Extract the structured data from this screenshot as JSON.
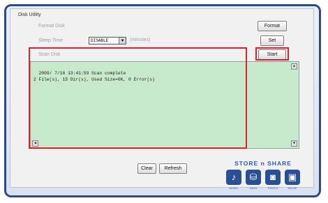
{
  "panel": {
    "title": "Disk Utility",
    "format_disk_label": "Format Disk",
    "sleep_time_label": "Sleep Time",
    "sleep_time_value": "DISABLE",
    "sleep_time_unit": "(minutes)",
    "scan_disk_label": "Scan Disk"
  },
  "buttons": {
    "format": "Format",
    "set": "Set",
    "start": "Start",
    "clear": "Clear",
    "refresh": "Refresh"
  },
  "log": {
    "text": "2009/ 7/16 13:41:59 Scan complete\n2 File(s), 15 Dir(s), Used Size=0K, 0 Error(s)"
  },
  "logo": {
    "title": "STORE n SHARE",
    "tiles": [
      {
        "icon": "music-icon",
        "glyph": "♪",
        "label": "MUSIC"
      },
      {
        "icon": "data-icon",
        "glyph": "⛁",
        "label": "DATA"
      },
      {
        "icon": "photo-icon",
        "glyph": "◙",
        "label": "PHOTO"
      },
      {
        "icon": "movie-icon",
        "glyph": "▣",
        "label": "MOVIE"
      }
    ]
  },
  "colors": {
    "frame": "#2d4a86",
    "log_background": "#c7eacc",
    "highlight": "#e0202a",
    "brand": "#2f5aa8"
  }
}
